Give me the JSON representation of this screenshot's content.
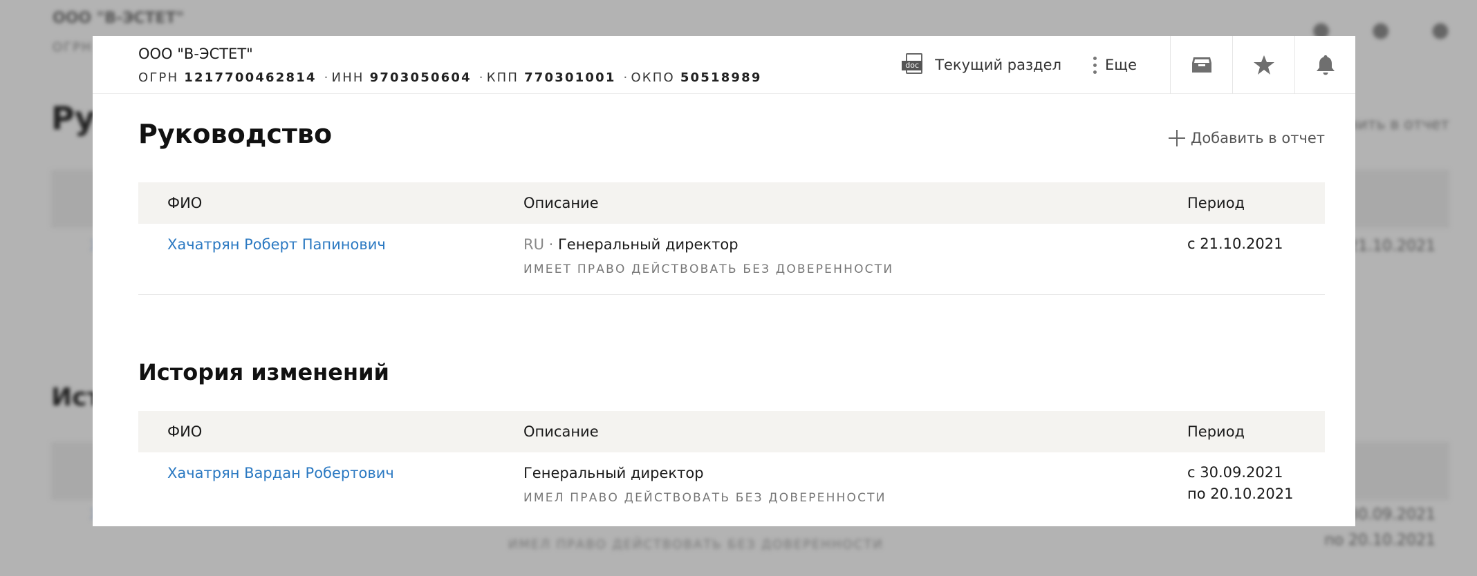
{
  "company": {
    "name": "ООО \"В-ЭСТЕТ\"",
    "ogrn_label": "ОГРН",
    "ogrn": "1217700462814",
    "inn_label": "ИНН",
    "inn": "9703050604",
    "kpp_label": "КПП",
    "kpp": "770301001",
    "okpo_label": "ОКПО",
    "okpo": "50518989"
  },
  "header": {
    "doc_icon_label": "doc",
    "current_section": "Текущий раздел",
    "more": "Еще"
  },
  "management": {
    "title": "Руководство",
    "add_to_report": "Добавить в отчет",
    "columns": [
      "ФИО",
      "Описание",
      "Период"
    ],
    "rows": [
      {
        "name": "Хачатрян Роберт Папинович",
        "country": "RU",
        "role": "Генеральный директор",
        "authority": "ИМЕЕТ ПРАВО ДЕЙСТВОВАТЬ БЕЗ ДОВЕРЕННОСТИ",
        "period_from": "с 21.10.2021"
      }
    ]
  },
  "history": {
    "title": "История изменений",
    "columns": [
      "ФИО",
      "Описание",
      "Период"
    ],
    "rows": [
      {
        "name": "Хачатрян Вардан Робертович",
        "role": "Генеральный директор",
        "authority": "ИМЕЛ ПРАВО ДЕЙСТВОВАТЬ БЕЗ ДОВЕРЕННОСТИ",
        "period_from": "с 30.09.2021",
        "period_to": "по 20.10.2021"
      }
    ]
  },
  "colors": {
    "link": "#2b79c2",
    "table_header_bg": "#f4f3f0",
    "overlay": "#b3b3b3"
  },
  "icons": [
    "doc-icon",
    "kebab-icon",
    "inbox-icon",
    "star-icon",
    "bell-icon",
    "plus-icon"
  ]
}
